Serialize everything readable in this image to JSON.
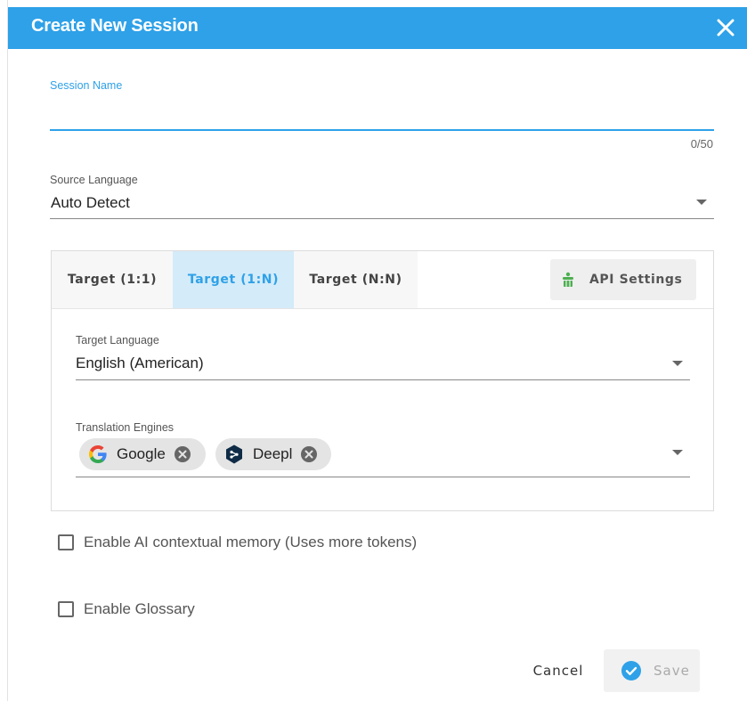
{
  "dialog": {
    "title": "Create New Session",
    "colors": {
      "header": "#2ea1e8",
      "accent": "#2ea1e8"
    }
  },
  "session_name": {
    "label": "Session Name",
    "value": "",
    "counter": "0/50"
  },
  "source_language": {
    "label": "Source Language",
    "value": "Auto Detect"
  },
  "target": {
    "tabs": [
      {
        "label": "Target (1:1)",
        "active": false
      },
      {
        "label": "Target (1:N)",
        "active": true
      },
      {
        "label": "Target (N:N)",
        "active": false
      }
    ],
    "api_settings_label": "API Settings",
    "target_language": {
      "label": "Target Language",
      "value": "English (American)"
    },
    "translation_engines": {
      "label": "Translation Engines",
      "chips": [
        {
          "label": "Google",
          "icon": "google-icon"
        },
        {
          "label": "Deepl",
          "icon": "deepl-icon"
        }
      ]
    }
  },
  "options": {
    "ai_memory_label": "Enable AI contextual memory (Uses more tokens)",
    "ai_memory_checked": false,
    "glossary_label": "Enable Glossary",
    "glossary_checked": false
  },
  "footer": {
    "cancel_label": "Cancel",
    "save_label": "Save"
  }
}
